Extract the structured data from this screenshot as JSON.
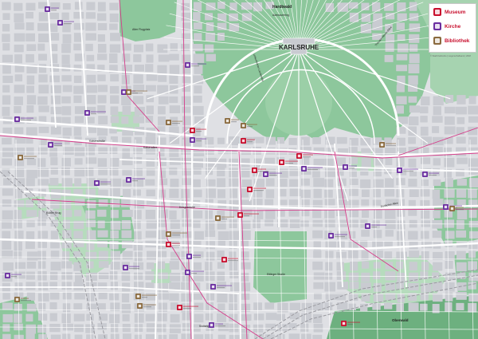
{
  "map": {
    "city_label": "KARLSRUHE",
    "colors": {
      "background": "#dfe0e4",
      "block": "#c9cbd1",
      "green": "#8dc79c",
      "green_light": "#b6dcbd",
      "forest": "#6db07f",
      "street": "#ffffff",
      "tram": "#d63c8a",
      "rail": "#9a9aa0"
    },
    "street_labels": {
      "hardtwald": "Hardtwald",
      "adenauerring": "Adenauerring",
      "kaiserstrasse": "Kaiserstraße",
      "kaiserallee": "Kaiserallee",
      "kriegsstrasse": "Kriegsstraße",
      "ettlinger_strasse": "Ettlinger Straße",
      "oberwald": "Oberwald",
      "alter_flugplatz": "Alter Flugplatz",
      "kuehler_krug": "Kühler Krug",
      "theodor_heuss_allee": "Theodor-Heuss-Allee",
      "durlacher_allee": "Durlacher Allee",
      "suedtangente": "Südtangente",
      "linkenheimer_landstrasse": "Linkenheimer Landstraße"
    }
  },
  "legend": {
    "items": [
      {
        "label": "Museum",
        "color": "#c8102e"
      },
      {
        "label": "Kirche",
        "color": "#6b2fa0"
      },
      {
        "label": "Bibliothek",
        "color": "#8a6a3e"
      }
    ],
    "credit": "© Stadt Karlsruhe | Liegenschaftsamt | 2018"
  },
  "poi_types": {
    "museum": {
      "color": "#c8102e"
    },
    "church": {
      "color": "#6b2fa0"
    },
    "library": {
      "color": "#8a6a3e"
    }
  }
}
